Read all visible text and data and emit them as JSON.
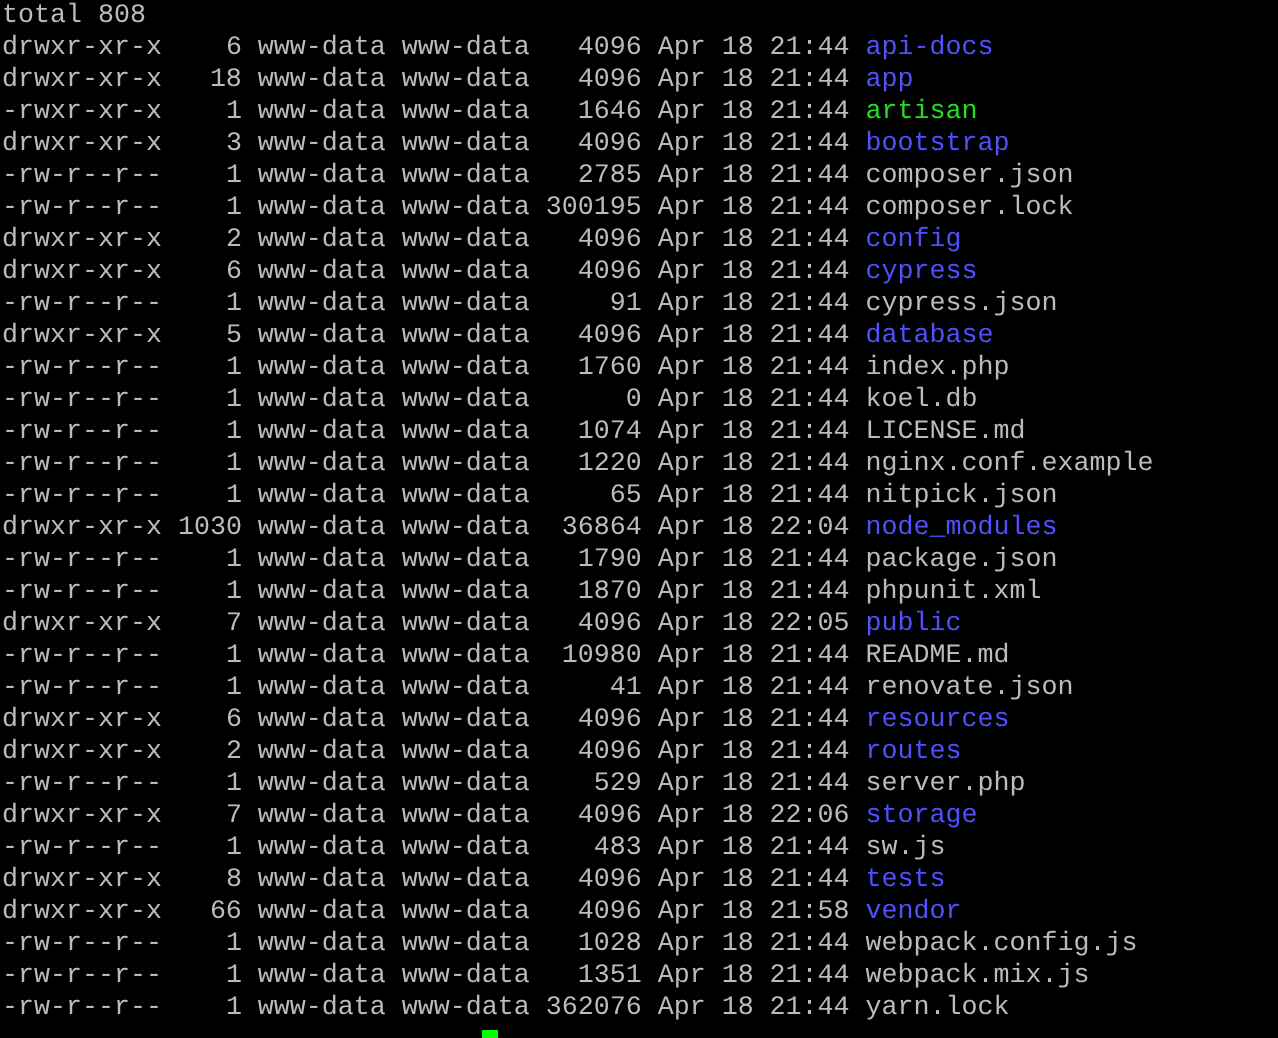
{
  "terminal": {
    "total": "total 808",
    "entries": [
      {
        "perms": "drwxr-xr-x",
        "links": "6",
        "owner": "www-data",
        "group": "www-data",
        "size": "4096",
        "date": "Apr 18",
        "time": "21:44",
        "name": "api-docs",
        "kind": "dir"
      },
      {
        "perms": "drwxr-xr-x",
        "links": "18",
        "owner": "www-data",
        "group": "www-data",
        "size": "4096",
        "date": "Apr 18",
        "time": "21:44",
        "name": "app",
        "kind": "dir"
      },
      {
        "perms": "-rwxr-xr-x",
        "links": "1",
        "owner": "www-data",
        "group": "www-data",
        "size": "1646",
        "date": "Apr 18",
        "time": "21:44",
        "name": "artisan",
        "kind": "exec"
      },
      {
        "perms": "drwxr-xr-x",
        "links": "3",
        "owner": "www-data",
        "group": "www-data",
        "size": "4096",
        "date": "Apr 18",
        "time": "21:44",
        "name": "bootstrap",
        "kind": "dir"
      },
      {
        "perms": "-rw-r--r--",
        "links": "1",
        "owner": "www-data",
        "group": "www-data",
        "size": "2785",
        "date": "Apr 18",
        "time": "21:44",
        "name": "composer.json",
        "kind": "file"
      },
      {
        "perms": "-rw-r--r--",
        "links": "1",
        "owner": "www-data",
        "group": "www-data",
        "size": "300195",
        "date": "Apr 18",
        "time": "21:44",
        "name": "composer.lock",
        "kind": "file"
      },
      {
        "perms": "drwxr-xr-x",
        "links": "2",
        "owner": "www-data",
        "group": "www-data",
        "size": "4096",
        "date": "Apr 18",
        "time": "21:44",
        "name": "config",
        "kind": "dir"
      },
      {
        "perms": "drwxr-xr-x",
        "links": "6",
        "owner": "www-data",
        "group": "www-data",
        "size": "4096",
        "date": "Apr 18",
        "time": "21:44",
        "name": "cypress",
        "kind": "dir"
      },
      {
        "perms": "-rw-r--r--",
        "links": "1",
        "owner": "www-data",
        "group": "www-data",
        "size": "91",
        "date": "Apr 18",
        "time": "21:44",
        "name": "cypress.json",
        "kind": "file"
      },
      {
        "perms": "drwxr-xr-x",
        "links": "5",
        "owner": "www-data",
        "group": "www-data",
        "size": "4096",
        "date": "Apr 18",
        "time": "21:44",
        "name": "database",
        "kind": "dir"
      },
      {
        "perms": "-rw-r--r--",
        "links": "1",
        "owner": "www-data",
        "group": "www-data",
        "size": "1760",
        "date": "Apr 18",
        "time": "21:44",
        "name": "index.php",
        "kind": "file"
      },
      {
        "perms": "-rw-r--r--",
        "links": "1",
        "owner": "www-data",
        "group": "www-data",
        "size": "0",
        "date": "Apr 18",
        "time": "21:44",
        "name": "koel.db",
        "kind": "file"
      },
      {
        "perms": "-rw-r--r--",
        "links": "1",
        "owner": "www-data",
        "group": "www-data",
        "size": "1074",
        "date": "Apr 18",
        "time": "21:44",
        "name": "LICENSE.md",
        "kind": "file"
      },
      {
        "perms": "-rw-r--r--",
        "links": "1",
        "owner": "www-data",
        "group": "www-data",
        "size": "1220",
        "date": "Apr 18",
        "time": "21:44",
        "name": "nginx.conf.example",
        "kind": "file"
      },
      {
        "perms": "-rw-r--r--",
        "links": "1",
        "owner": "www-data",
        "group": "www-data",
        "size": "65",
        "date": "Apr 18",
        "time": "21:44",
        "name": "nitpick.json",
        "kind": "file"
      },
      {
        "perms": "drwxr-xr-x",
        "links": "1030",
        "owner": "www-data",
        "group": "www-data",
        "size": "36864",
        "date": "Apr 18",
        "time": "22:04",
        "name": "node_modules",
        "kind": "dir"
      },
      {
        "perms": "-rw-r--r--",
        "links": "1",
        "owner": "www-data",
        "group": "www-data",
        "size": "1790",
        "date": "Apr 18",
        "time": "21:44",
        "name": "package.json",
        "kind": "file"
      },
      {
        "perms": "-rw-r--r--",
        "links": "1",
        "owner": "www-data",
        "group": "www-data",
        "size": "1870",
        "date": "Apr 18",
        "time": "21:44",
        "name": "phpunit.xml",
        "kind": "file"
      },
      {
        "perms": "drwxr-xr-x",
        "links": "7",
        "owner": "www-data",
        "group": "www-data",
        "size": "4096",
        "date": "Apr 18",
        "time": "22:05",
        "name": "public",
        "kind": "dir"
      },
      {
        "perms": "-rw-r--r--",
        "links": "1",
        "owner": "www-data",
        "group": "www-data",
        "size": "10980",
        "date": "Apr 18",
        "time": "21:44",
        "name": "README.md",
        "kind": "file"
      },
      {
        "perms": "-rw-r--r--",
        "links": "1",
        "owner": "www-data",
        "group": "www-data",
        "size": "41",
        "date": "Apr 18",
        "time": "21:44",
        "name": "renovate.json",
        "kind": "file"
      },
      {
        "perms": "drwxr-xr-x",
        "links": "6",
        "owner": "www-data",
        "group": "www-data",
        "size": "4096",
        "date": "Apr 18",
        "time": "21:44",
        "name": "resources",
        "kind": "dir"
      },
      {
        "perms": "drwxr-xr-x",
        "links": "2",
        "owner": "www-data",
        "group": "www-data",
        "size": "4096",
        "date": "Apr 18",
        "time": "21:44",
        "name": "routes",
        "kind": "dir"
      },
      {
        "perms": "-rw-r--r--",
        "links": "1",
        "owner": "www-data",
        "group": "www-data",
        "size": "529",
        "date": "Apr 18",
        "time": "21:44",
        "name": "server.php",
        "kind": "file"
      },
      {
        "perms": "drwxr-xr-x",
        "links": "7",
        "owner": "www-data",
        "group": "www-data",
        "size": "4096",
        "date": "Apr 18",
        "time": "22:06",
        "name": "storage",
        "kind": "dir"
      },
      {
        "perms": "-rw-r--r--",
        "links": "1",
        "owner": "www-data",
        "group": "www-data",
        "size": "483",
        "date": "Apr 18",
        "time": "21:44",
        "name": "sw.js",
        "kind": "file"
      },
      {
        "perms": "drwxr-xr-x",
        "links": "8",
        "owner": "www-data",
        "group": "www-data",
        "size": "4096",
        "date": "Apr 18",
        "time": "21:44",
        "name": "tests",
        "kind": "dir"
      },
      {
        "perms": "drwxr-xr-x",
        "links": "66",
        "owner": "www-data",
        "group": "www-data",
        "size": "4096",
        "date": "Apr 18",
        "time": "21:58",
        "name": "vendor",
        "kind": "dir"
      },
      {
        "perms": "-rw-r--r--",
        "links": "1",
        "owner": "www-data",
        "group": "www-data",
        "size": "1028",
        "date": "Apr 18",
        "time": "21:44",
        "name": "webpack.config.js",
        "kind": "file"
      },
      {
        "perms": "-rw-r--r--",
        "links": "1",
        "owner": "www-data",
        "group": "www-data",
        "size": "1351",
        "date": "Apr 18",
        "time": "21:44",
        "name": "webpack.mix.js",
        "kind": "file"
      },
      {
        "perms": "-rw-r--r--",
        "links": "1",
        "owner": "www-data",
        "group": "www-data",
        "size": "362076",
        "date": "Apr 18",
        "time": "21:44",
        "name": "yarn.lock",
        "kind": "file"
      }
    ]
  }
}
